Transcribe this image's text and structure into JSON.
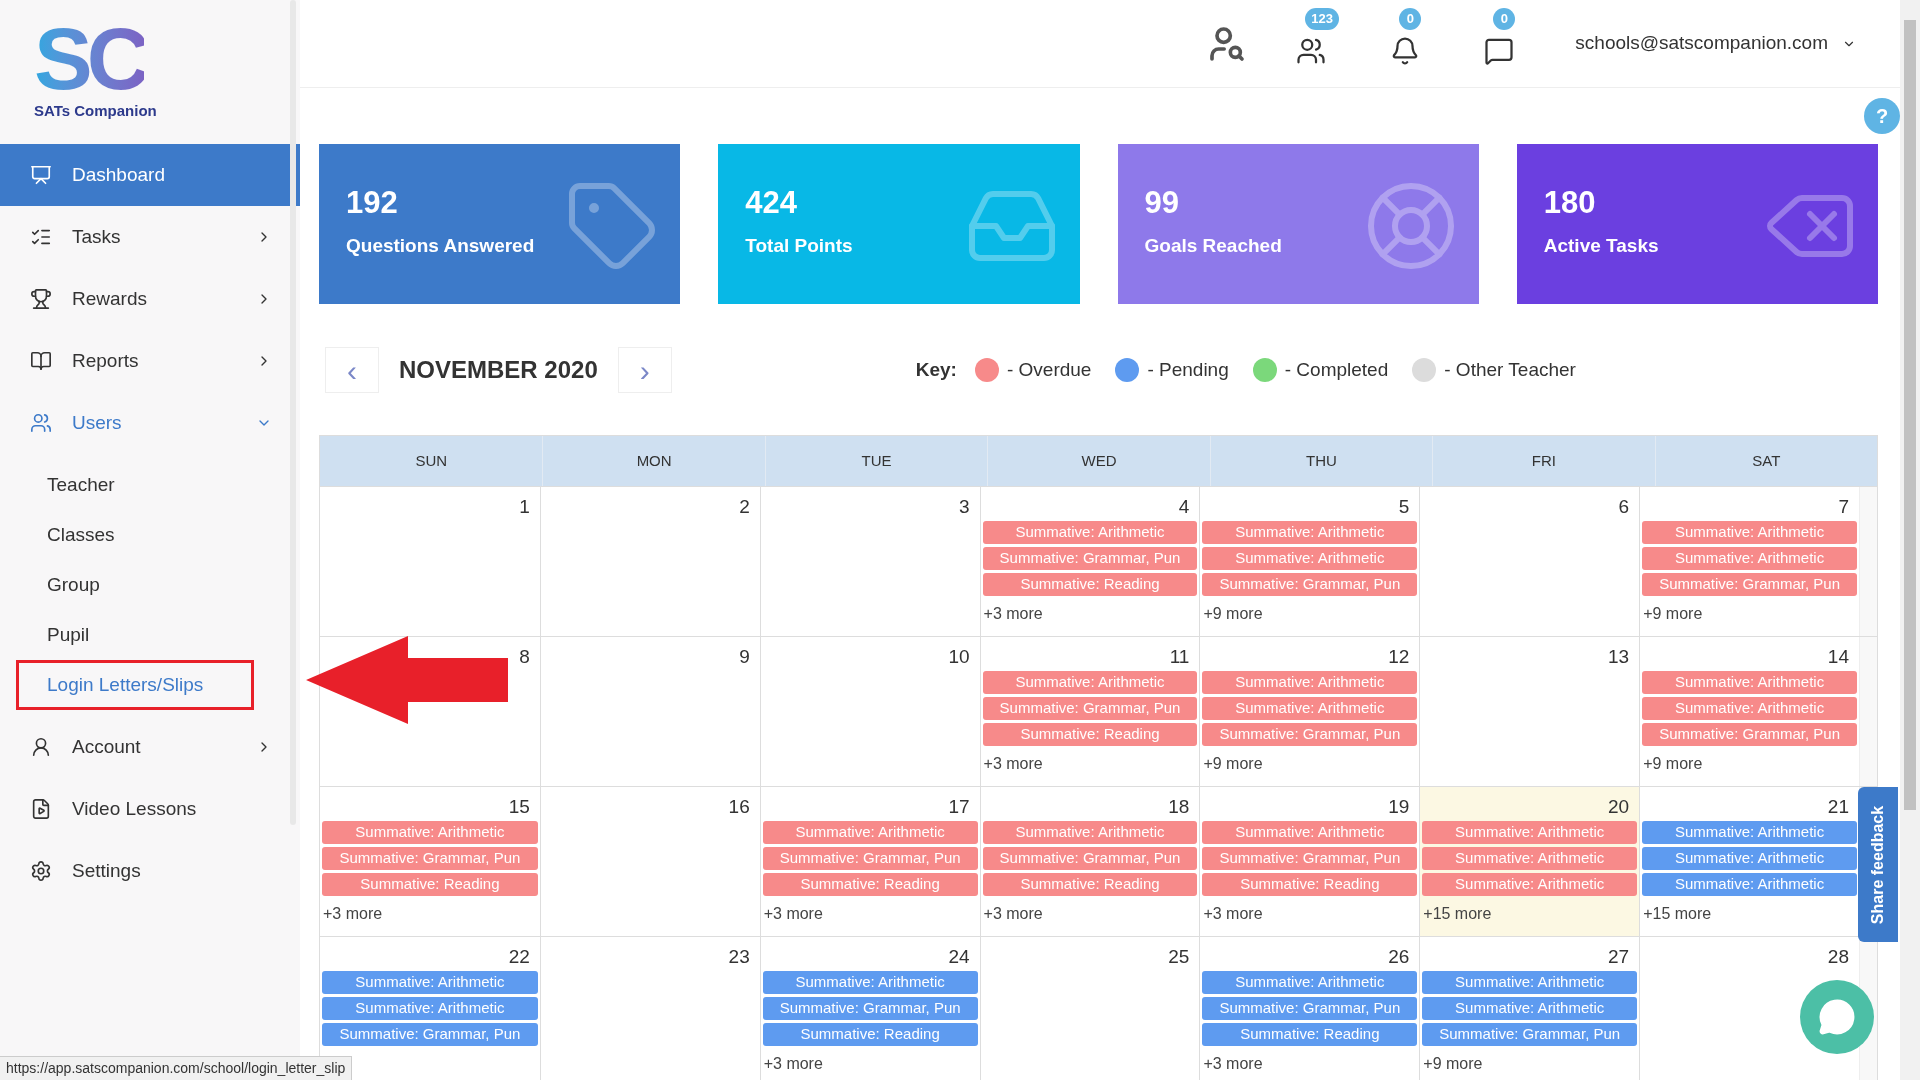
{
  "logo": {
    "mark": "SC",
    "name": "SATs Companion"
  },
  "sidebar": {
    "items": [
      {
        "kind": "dashboard",
        "label": "Dashboard",
        "selected": true,
        "expanded": false,
        "has_submenu": false
      },
      {
        "kind": "tasks",
        "label": "Tasks",
        "selected": false,
        "expanded": false,
        "has_submenu": true
      },
      {
        "kind": "rewards",
        "label": "Rewards",
        "selected": false,
        "expanded": false,
        "has_submenu": true
      },
      {
        "kind": "reports",
        "label": "Reports",
        "selected": false,
        "expanded": false,
        "has_submenu": true
      },
      {
        "kind": "users",
        "label": "Users",
        "selected": false,
        "expanded": true,
        "has_submenu": true,
        "children": [
          {
            "label": "Teacher",
            "selected": false,
            "boxed": false
          },
          {
            "label": "Classes",
            "selected": false,
            "boxed": false
          },
          {
            "label": "Group",
            "selected": false,
            "boxed": false
          },
          {
            "label": "Pupil",
            "selected": false,
            "boxed": false
          },
          {
            "label": "Login Letters/Slips",
            "selected": true,
            "boxed": true
          }
        ]
      },
      {
        "kind": "account",
        "label": "Account",
        "selected": false,
        "expanded": false,
        "has_submenu": true
      },
      {
        "kind": "video",
        "label": "Video Lessons",
        "selected": false,
        "expanded": false,
        "has_submenu": false
      },
      {
        "kind": "settings",
        "label": "Settings",
        "selected": false,
        "expanded": false,
        "has_submenu": false
      }
    ]
  },
  "header": {
    "badges": [
      {
        "kind": "users",
        "count": "123"
      },
      {
        "kind": "bell",
        "count": "0"
      },
      {
        "kind": "chat",
        "count": "0"
      }
    ],
    "account": "schools@satscompanion.com",
    "help": "?"
  },
  "cards": [
    {
      "kind": "tag",
      "value": "192",
      "label": "Questions Answered",
      "color": "#3d7ac9"
    },
    {
      "kind": "inbox",
      "value": "424",
      "label": "Total Points",
      "color": "#08b8e6"
    },
    {
      "kind": "buoy",
      "value": "99",
      "label": "Goals Reached",
      "color": "#8e79ea"
    },
    {
      "kind": "delete",
      "value": "180",
      "label": "Active Tasks",
      "color": "#6b3fe0"
    }
  ],
  "calendar": {
    "prev": "‹",
    "next": "›",
    "month": "NOVEMBER 2020",
    "key_label": "Key:",
    "key": [
      {
        "label": "- Overdue",
        "color": "#f78a8a"
      },
      {
        "label": "- Pending",
        "color": "#5e9bf0"
      },
      {
        "label": "- Completed",
        "color": "#7bd87b"
      },
      {
        "label": "- Other Teacher",
        "color": "#dcdcdc"
      }
    ],
    "days": [
      "SUN",
      "MON",
      "TUE",
      "WED",
      "THU",
      "FRI",
      "SAT"
    ],
    "weeks": [
      [
        {
          "day": "1",
          "today": false
        },
        {
          "day": "2",
          "today": false
        },
        {
          "day": "3",
          "today": false
        },
        {
          "day": "4",
          "today": false,
          "events": [
            {
              "title": "Summative: Arithmetic",
              "color": "#f78a8a"
            },
            {
              "title": "Summative: Grammar, Pun",
              "color": "#f78a8a"
            },
            {
              "title": "Summative: Reading",
              "color": "#f78a8a"
            }
          ],
          "more": "+3 more"
        },
        {
          "day": "5",
          "today": false,
          "events": [
            {
              "title": "Summative: Arithmetic",
              "color": "#f78a8a"
            },
            {
              "title": "Summative: Arithmetic",
              "color": "#f78a8a"
            },
            {
              "title": "Summative: Grammar, Pun",
              "color": "#f78a8a"
            }
          ],
          "more": "+9 more"
        },
        {
          "day": "6",
          "today": false
        },
        {
          "day": "7",
          "today": false,
          "events": [
            {
              "title": "Summative: Arithmetic",
              "color": "#f78a8a"
            },
            {
              "title": "Summative: Arithmetic",
              "color": "#f78a8a"
            },
            {
              "title": "Summative: Grammar, Pun",
              "color": "#f78a8a"
            }
          ],
          "more": "+9 more"
        }
      ],
      [
        {
          "day": "8",
          "today": false
        },
        {
          "day": "9",
          "today": false
        },
        {
          "day": "10",
          "today": false
        },
        {
          "day": "11",
          "today": false,
          "events": [
            {
              "title": "Summative: Arithmetic",
              "color": "#f78a8a"
            },
            {
              "title": "Summative: Grammar, Pun",
              "color": "#f78a8a"
            },
            {
              "title": "Summative: Reading",
              "color": "#f78a8a"
            }
          ],
          "more": "+3 more"
        },
        {
          "day": "12",
          "today": false,
          "events": [
            {
              "title": "Summative: Arithmetic",
              "color": "#f78a8a"
            },
            {
              "title": "Summative: Arithmetic",
              "color": "#f78a8a"
            },
            {
              "title": "Summative: Grammar, Pun",
              "color": "#f78a8a"
            }
          ],
          "more": "+9 more"
        },
        {
          "day": "13",
          "today": false
        },
        {
          "day": "14",
          "today": false,
          "events": [
            {
              "title": "Summative: Arithmetic",
              "color": "#f78a8a"
            },
            {
              "title": "Summative: Arithmetic",
              "color": "#f78a8a"
            },
            {
              "title": "Summative: Grammar, Pun",
              "color": "#f78a8a"
            }
          ],
          "more": "+9 more"
        }
      ],
      [
        {
          "day": "15",
          "today": false,
          "events": [
            {
              "title": "Summative: Arithmetic",
              "color": "#f78a8a"
            },
            {
              "title": "Summative: Grammar, Pun",
              "color": "#f78a8a"
            },
            {
              "title": "Summative: Reading",
              "color": "#f78a8a"
            }
          ],
          "more": "+3 more"
        },
        {
          "day": "16",
          "today": false
        },
        {
          "day": "17",
          "today": false,
          "events": [
            {
              "title": "Summative: Arithmetic",
              "color": "#f78a8a"
            },
            {
              "title": "Summative: Grammar, Pun",
              "color": "#f78a8a"
            },
            {
              "title": "Summative: Reading",
              "color": "#f78a8a"
            }
          ],
          "more": "+3 more"
        },
        {
          "day": "18",
          "today": false,
          "events": [
            {
              "title": "Summative: Arithmetic",
              "color": "#f78a8a"
            },
            {
              "title": "Summative: Grammar, Pun",
              "color": "#f78a8a"
            },
            {
              "title": "Summative: Reading",
              "color": "#f78a8a"
            }
          ],
          "more": "+3 more"
        },
        {
          "day": "19",
          "today": false,
          "events": [
            {
              "title": "Summative: Arithmetic",
              "color": "#f78a8a"
            },
            {
              "title": "Summative: Grammar, Pun",
              "color": "#f78a8a"
            },
            {
              "title": "Summative: Reading",
              "color": "#f78a8a"
            }
          ],
          "more": "+3 more"
        },
        {
          "day": "20",
          "today": true,
          "events": [
            {
              "title": "Summative: Arithmetic",
              "color": "#f78a8a"
            },
            {
              "title": "Summative: Arithmetic",
              "color": "#f78a8a"
            },
            {
              "title": "Summative: Arithmetic",
              "color": "#f78a8a"
            }
          ],
          "more": "+15 more"
        },
        {
          "day": "21",
          "today": false,
          "events": [
            {
              "title": "Summative: Arithmetic",
              "color": "#5e9bf0"
            },
            {
              "title": "Summative: Arithmetic",
              "color": "#5e9bf0"
            },
            {
              "title": "Summative: Arithmetic",
              "color": "#5e9bf0"
            }
          ],
          "more": "+15 more"
        }
      ],
      [
        {
          "day": "22",
          "today": false,
          "events": [
            {
              "title": "Summative: Arithmetic",
              "color": "#5e9bf0"
            },
            {
              "title": "Summative: Arithmetic",
              "color": "#5e9bf0"
            },
            {
              "title": "Summative: Grammar, Pun",
              "color": "#5e9bf0"
            }
          ]
        },
        {
          "day": "23",
          "today": false
        },
        {
          "day": "24",
          "today": false,
          "events": [
            {
              "title": "Summative: Arithmetic",
              "color": "#5e9bf0"
            },
            {
              "title": "Summative: Grammar, Pun",
              "color": "#5e9bf0"
            },
            {
              "title": "Summative: Reading",
              "color": "#5e9bf0"
            }
          ],
          "more": "+3 more"
        },
        {
          "day": "25",
          "today": false
        },
        {
          "day": "26",
          "today": false,
          "events": [
            {
              "title": "Summative: Arithmetic",
              "color": "#5e9bf0"
            },
            {
              "title": "Summative: Grammar, Pun",
              "color": "#5e9bf0"
            },
            {
              "title": "Summative: Reading",
              "color": "#5e9bf0"
            }
          ],
          "more": "+3 more"
        },
        {
          "day": "27",
          "today": false,
          "events": [
            {
              "title": "Summative: Arithmetic",
              "color": "#5e9bf0"
            },
            {
              "title": "Summative: Arithmetic",
              "color": "#5e9bf0"
            },
            {
              "title": "Summative: Grammar, Pun",
              "color": "#5e9bf0"
            }
          ],
          "more": "+9 more"
        },
        {
          "day": "28",
          "today": false
        }
      ]
    ]
  },
  "feedback": "Share feedback",
  "status_bar": "https://app.satscompanion.com/school/login_letter_slip"
}
